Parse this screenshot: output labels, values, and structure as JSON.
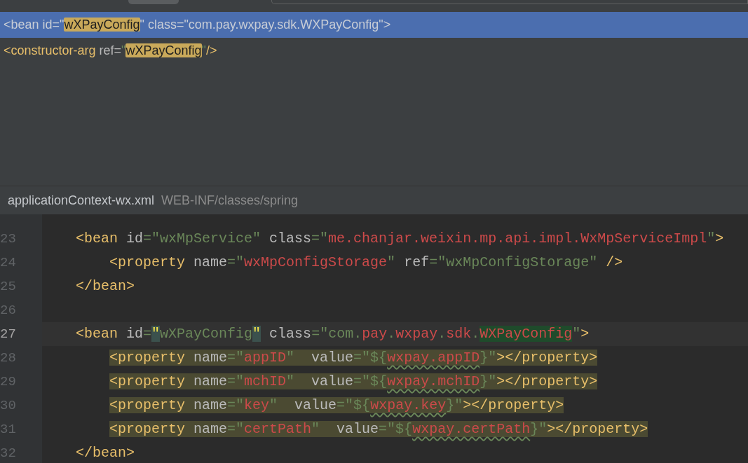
{
  "usages": [
    {
      "selected": true,
      "tokens": [
        {
          "text": "<bean id=\"",
          "kind": "attr"
        },
        {
          "text": "wXPayConfig",
          "kind": "hit"
        },
        {
          "text": "\" class=\"com.pay.wxpay.sdk.WXPayConfig\">",
          "kind": "attr"
        }
      ]
    },
    {
      "selected": false,
      "tokens": [
        {
          "text": "<constructor-arg",
          "kind": "tag"
        },
        {
          "text": " ref=",
          "kind": "attr"
        },
        {
          "text": "\"",
          "kind": "str"
        },
        {
          "text": "wXPayConfig",
          "kind": "hit"
        },
        {
          "text": "\"",
          "kind": "str"
        },
        {
          "text": "/>",
          "kind": "tag"
        }
      ]
    }
  ],
  "file": {
    "name": "applicationContext-wx.xml",
    "path": "WEB-INF/classes/spring"
  },
  "lines": [
    {
      "number": "23",
      "current": false,
      "highlighted": false,
      "kind": "outer",
      "tokens": [
        {
          "text": "<bean",
          "kind": "tag"
        },
        {
          "text": " id",
          "kind": "attr"
        },
        {
          "text": "=\"wxMpService\"",
          "kind": "str"
        },
        {
          "text": " class",
          "kind": "attr"
        },
        {
          "text": "=\"",
          "kind": "str"
        },
        {
          "text": "me.chanjar.weixin.mp.api.impl.WxMpServiceImpl",
          "kind": "red"
        },
        {
          "text": "\"",
          "kind": "str"
        },
        {
          "text": ">",
          "kind": "tag"
        }
      ]
    },
    {
      "number": "24",
      "current": false,
      "highlighted": false,
      "kind": "inner",
      "tokens": [
        {
          "text": "<property",
          "kind": "tag"
        },
        {
          "text": " name",
          "kind": "attr"
        },
        {
          "text": "=\"",
          "kind": "str"
        },
        {
          "text": "wxMpConfigStorage",
          "kind": "red"
        },
        {
          "text": "\"",
          "kind": "str"
        },
        {
          "text": " ref",
          "kind": "attr"
        },
        {
          "text": "=\"wxMpConfigStorage\"",
          "kind": "str"
        },
        {
          "text": " />",
          "kind": "tag"
        }
      ]
    },
    {
      "number": "25",
      "current": false,
      "highlighted": false,
      "kind": "outer",
      "tokens": [
        {
          "text": "</bean>",
          "kind": "tag"
        }
      ]
    },
    {
      "number": "26",
      "current": false
    },
    {
      "number": "27",
      "current": true,
      "highlighted": false,
      "kind": "outer",
      "tokens": [
        {
          "text": "<bean",
          "kind": "tag"
        },
        {
          "text": " id",
          "kind": "attr"
        },
        {
          "text": "=",
          "kind": "str"
        },
        {
          "text": "\"",
          "kind": "quote-match"
        },
        {
          "text": "wXPayConfig",
          "kind": "str"
        },
        {
          "text": "\"",
          "kind": "quote-match"
        },
        {
          "text": " class",
          "kind": "attr"
        },
        {
          "text": "=\"com.",
          "kind": "str"
        },
        {
          "text": "pay",
          "kind": "red"
        },
        {
          "text": ".",
          "kind": "str"
        },
        {
          "text": "wxpay",
          "kind": "red"
        },
        {
          "text": ".",
          "kind": "str"
        },
        {
          "text": "sdk",
          "kind": "red"
        },
        {
          "text": ".",
          "kind": "str"
        },
        {
          "text": "WXPayConfig",
          "kind": "red-boxed"
        },
        {
          "text": "\"",
          "kind": "str"
        },
        {
          "text": ">",
          "kind": "tag"
        }
      ]
    },
    {
      "number": "28",
      "current": false,
      "highlighted": true,
      "kind": "inner",
      "tokens": [
        {
          "text": "<property",
          "kind": "tag"
        },
        {
          "text": " name",
          "kind": "attr"
        },
        {
          "text": "=\"",
          "kind": "str"
        },
        {
          "text": "appID",
          "kind": "red"
        },
        {
          "text": "\"",
          "kind": "str"
        },
        {
          "text": "  value",
          "kind": "attr"
        },
        {
          "text": "=\"${",
          "kind": "str"
        },
        {
          "text": "wxpay.appID",
          "kind": "red-underline"
        },
        {
          "text": "}\"",
          "kind": "str"
        },
        {
          "text": "></property>",
          "kind": "tag"
        }
      ]
    },
    {
      "number": "29",
      "current": false,
      "highlighted": true,
      "kind": "inner",
      "tokens": [
        {
          "text": "<property",
          "kind": "tag"
        },
        {
          "text": " name",
          "kind": "attr"
        },
        {
          "text": "=\"",
          "kind": "str"
        },
        {
          "text": "mchID",
          "kind": "red"
        },
        {
          "text": "\"",
          "kind": "str"
        },
        {
          "text": "  value",
          "kind": "attr"
        },
        {
          "text": "=\"${",
          "kind": "str"
        },
        {
          "text": "wxpay.mchID",
          "kind": "red-underline"
        },
        {
          "text": "}\"",
          "kind": "str"
        },
        {
          "text": "></property>",
          "kind": "tag"
        }
      ]
    },
    {
      "number": "30",
      "current": false,
      "highlighted": true,
      "kind": "inner",
      "tokens": [
        {
          "text": "<property",
          "kind": "tag"
        },
        {
          "text": " name",
          "kind": "attr"
        },
        {
          "text": "=\"",
          "kind": "str"
        },
        {
          "text": "key",
          "kind": "red"
        },
        {
          "text": "\"",
          "kind": "str"
        },
        {
          "text": "  value",
          "kind": "attr"
        },
        {
          "text": "=\"${",
          "kind": "str"
        },
        {
          "text": "wxpay.key",
          "kind": "red-underline"
        },
        {
          "text": "}\"",
          "kind": "str"
        },
        {
          "text": "></property>",
          "kind": "tag"
        }
      ]
    },
    {
      "number": "31",
      "current": false,
      "highlighted": true,
      "kind": "inner",
      "tokens": [
        {
          "text": "<property",
          "kind": "tag"
        },
        {
          "text": " name",
          "kind": "attr"
        },
        {
          "text": "=\"",
          "kind": "str"
        },
        {
          "text": "certPath",
          "kind": "red"
        },
        {
          "text": "\"",
          "kind": "str"
        },
        {
          "text": "  value",
          "kind": "attr"
        },
        {
          "text": "=\"${",
          "kind": "str"
        },
        {
          "text": "wxpay.certPath",
          "kind": "red-underline"
        },
        {
          "text": "}\"",
          "kind": "str"
        },
        {
          "text": "></property>",
          "kind": "tag"
        }
      ]
    },
    {
      "number": "32",
      "current": false,
      "highlighted": false,
      "kind": "outer",
      "tokens": [
        {
          "text": "</bean>",
          "kind": "tag"
        }
      ]
    }
  ]
}
